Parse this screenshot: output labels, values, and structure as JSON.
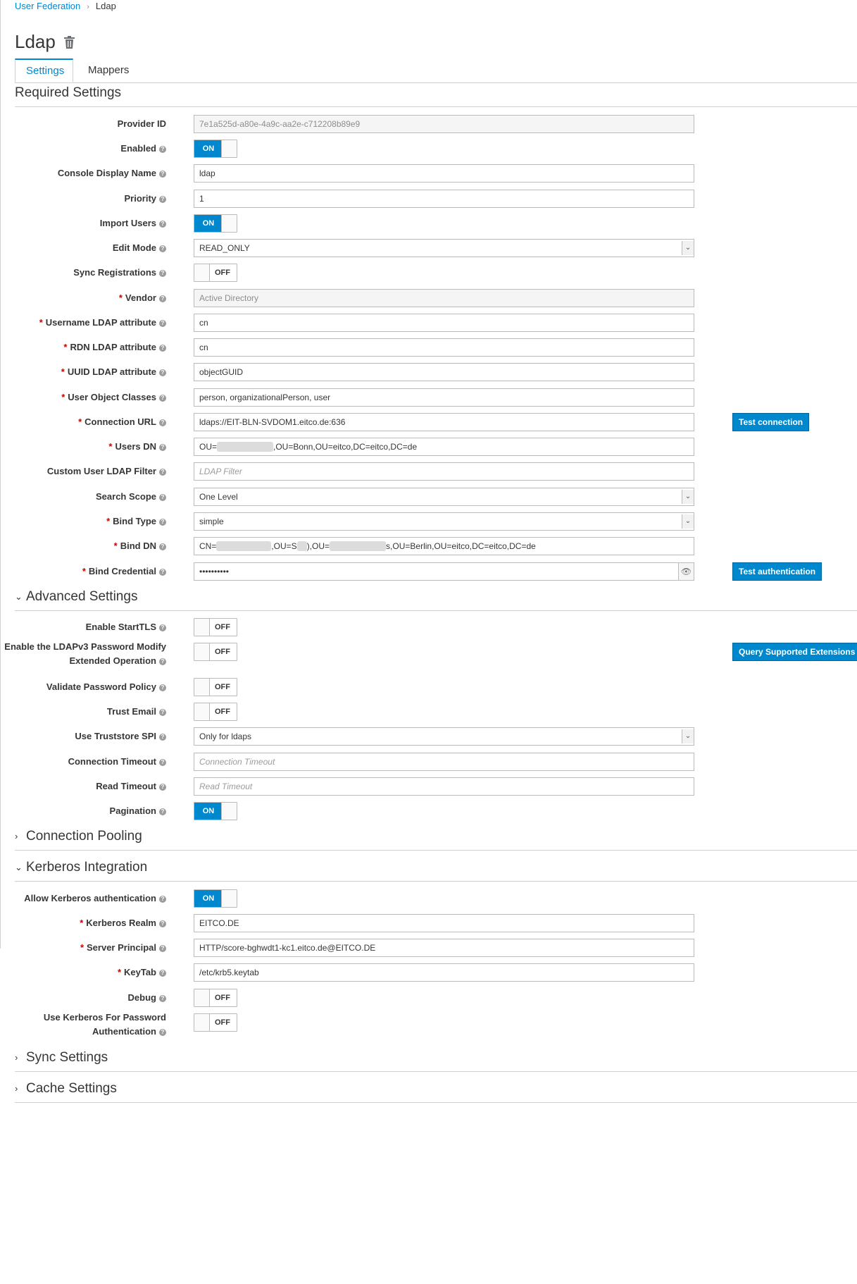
{
  "breadcrumb": {
    "parent": "User Federation",
    "separator": "›",
    "current": "Ldap"
  },
  "page": {
    "title": "Ldap"
  },
  "tabs": {
    "settings": "Settings",
    "mappers": "Mappers"
  },
  "sections": {
    "required": "Required Settings",
    "advanced": "Advanced Settings",
    "pooling": "Connection Pooling",
    "kerberos": "Kerberos Integration",
    "sync": "Sync Settings",
    "cache": "Cache Settings"
  },
  "toggle": {
    "on": "ON",
    "off": "OFF"
  },
  "required": {
    "provider_id": {
      "label": "Provider ID",
      "value": "7e1a525d-a80e-4a9c-aa2e-c712208b89e9"
    },
    "enabled": {
      "label": "Enabled"
    },
    "console_display_name": {
      "label": "Console Display Name",
      "value": "ldap"
    },
    "priority": {
      "label": "Priority",
      "value": "1"
    },
    "import_users": {
      "label": "Import Users"
    },
    "edit_mode": {
      "label": "Edit Mode",
      "value": "READ_ONLY"
    },
    "sync_registrations": {
      "label": "Sync Registrations"
    },
    "vendor": {
      "label": "Vendor",
      "value": "Active Directory"
    },
    "username_attr": {
      "label": "Username LDAP attribute",
      "value": "cn"
    },
    "rdn_attr": {
      "label": "RDN LDAP attribute",
      "value": "cn"
    },
    "uuid_attr": {
      "label": "UUID LDAP attribute",
      "value": "objectGUID"
    },
    "user_object_classes": {
      "label": "User Object Classes",
      "value": "person, organizationalPerson, user"
    },
    "connection_url": {
      "label": "Connection URL",
      "value": "ldaps://EIT-BLN-SVDOM1.eitco.de:636",
      "button": "Test connection"
    },
    "users_dn": {
      "label": "Users DN",
      "value_prefix": "OU=",
      "value_suffix": ",OU=Bonn,OU=eitco,DC=eitco,DC=de"
    },
    "custom_filter": {
      "label": "Custom User LDAP Filter",
      "placeholder": "LDAP Filter"
    },
    "search_scope": {
      "label": "Search Scope",
      "value": "One Level"
    },
    "bind_type": {
      "label": "Bind Type",
      "value": "simple"
    },
    "bind_dn": {
      "label": "Bind DN",
      "p1": "CN=",
      "p2": ",OU=S",
      "p3": "),OU=",
      "p4": "s,OU=Berlin,OU=eitco,DC=eitco,DC=de"
    },
    "bind_credential": {
      "label": "Bind Credential",
      "value": "••••••••••",
      "button": "Test authentication"
    }
  },
  "advanced": {
    "starttls": {
      "label": "Enable StartTLS"
    },
    "ldapv3": {
      "label_line1": "Enable the LDAPv3 Password Modify",
      "label_line2": "Extended Operation",
      "button": "Query Supported Extensions"
    },
    "validate_policy": {
      "label": "Validate Password Policy"
    },
    "trust_email": {
      "label": "Trust Email"
    },
    "truststore": {
      "label": "Use Truststore SPI",
      "value": "Only for ldaps"
    },
    "conn_timeout": {
      "label": "Connection Timeout",
      "placeholder": "Connection Timeout"
    },
    "read_timeout": {
      "label": "Read Timeout",
      "placeholder": "Read Timeout"
    },
    "pagination": {
      "label": "Pagination"
    }
  },
  "kerberos": {
    "allow": {
      "label": "Allow Kerberos authentication"
    },
    "realm": {
      "label": "Kerberos Realm",
      "value": "EITCO.DE"
    },
    "principal": {
      "label": "Server Principal",
      "value": "HTTP/score-bghwdt1-kc1.eitco.de@EITCO.DE"
    },
    "keytab": {
      "label": "KeyTab",
      "value": "/etc/krb5.keytab"
    },
    "debug": {
      "label": "Debug"
    },
    "use_for_password": {
      "label_line1": "Use Kerberos For Password",
      "label_line2": "Authentication"
    }
  }
}
